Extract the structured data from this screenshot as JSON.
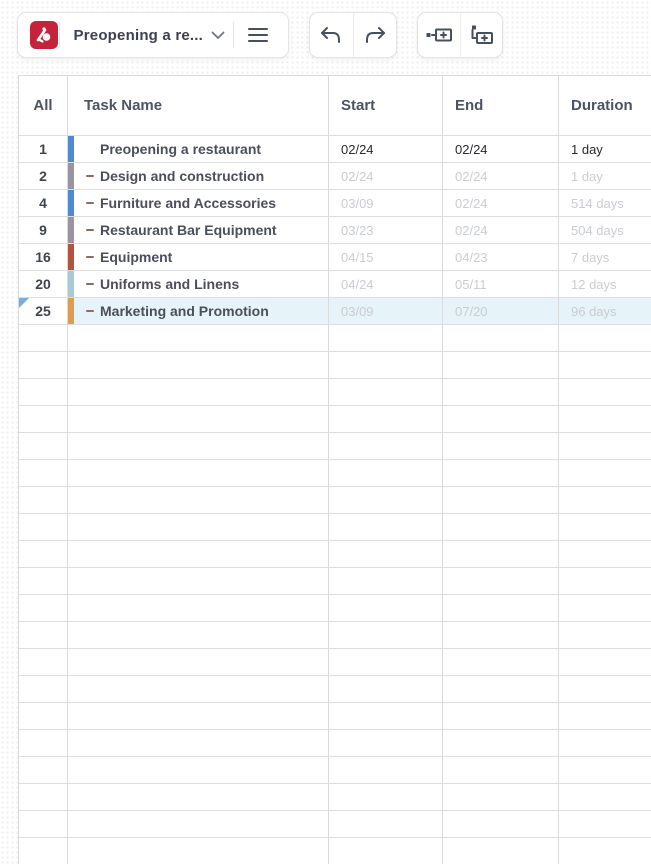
{
  "toolbar": {
    "document_title": "Preopening a re...",
    "logo_color": "#c4233b",
    "buttons": {
      "menu": "menu",
      "undo": "undo",
      "redo": "redo",
      "insert_task": "insert task",
      "insert_subtask": "insert subtask"
    }
  },
  "table": {
    "headers": {
      "all": "All",
      "task": "Task Name",
      "start": "Start",
      "end": "End",
      "duration": "Duration"
    },
    "rows": [
      {
        "num": "1",
        "name": "Preopening a restaurant",
        "has_dash": false,
        "start": "02/24",
        "end": "02/24",
        "duration": "1 day",
        "bar_color": "#4c8bd2",
        "bar_textured": false,
        "values_muted": false,
        "selected": false
      },
      {
        "num": "2",
        "name": "Design and construction",
        "has_dash": true,
        "start": "02/24",
        "end": "02/24",
        "duration": "1 day",
        "bar_color": "#9b94a0",
        "bar_textured": false,
        "values_muted": true,
        "selected": false
      },
      {
        "num": "4",
        "name": "Furniture and Accessories",
        "has_dash": true,
        "start": "03/09",
        "end": "02/24",
        "duration": "514 days",
        "bar_color": "#4c8bd2",
        "bar_textured": false,
        "values_muted": true,
        "selected": false
      },
      {
        "num": "9",
        "name": "Restaurant Bar Equipment",
        "has_dash": true,
        "start": "03/23",
        "end": "02/24",
        "duration": "504 days",
        "bar_color": "#9b94a0",
        "bar_textured": false,
        "values_muted": true,
        "selected": false
      },
      {
        "num": "16",
        "name": "Equipment",
        "has_dash": true,
        "start": "04/15",
        "end": "04/23",
        "duration": "7 days",
        "bar_color": "#b0543d",
        "bar_textured": true,
        "values_muted": true,
        "selected": false
      },
      {
        "num": "20",
        "name": "Uniforms and Linens",
        "has_dash": true,
        "start": "04/24",
        "end": "05/11",
        "duration": "12 days",
        "bar_color": "#a7cad6",
        "bar_textured": false,
        "values_muted": true,
        "selected": false
      },
      {
        "num": "25",
        "name": "Marketing and Promotion",
        "has_dash": true,
        "start": "03/09",
        "end": "07/20",
        "duration": "96 days",
        "bar_color": "#e09b52",
        "bar_textured": false,
        "values_muted": true,
        "selected": true
      }
    ],
    "empty_rows": 20
  },
  "colors": {
    "selected_row_bg": "#e6f3f8",
    "selection_corner": "#79aedc",
    "grid_line": "#d8dadb",
    "muted_text": "#c9ccd1",
    "dark_text": "#26292e",
    "header_text": "#4c5364",
    "logo_red": "#c4233b"
  }
}
